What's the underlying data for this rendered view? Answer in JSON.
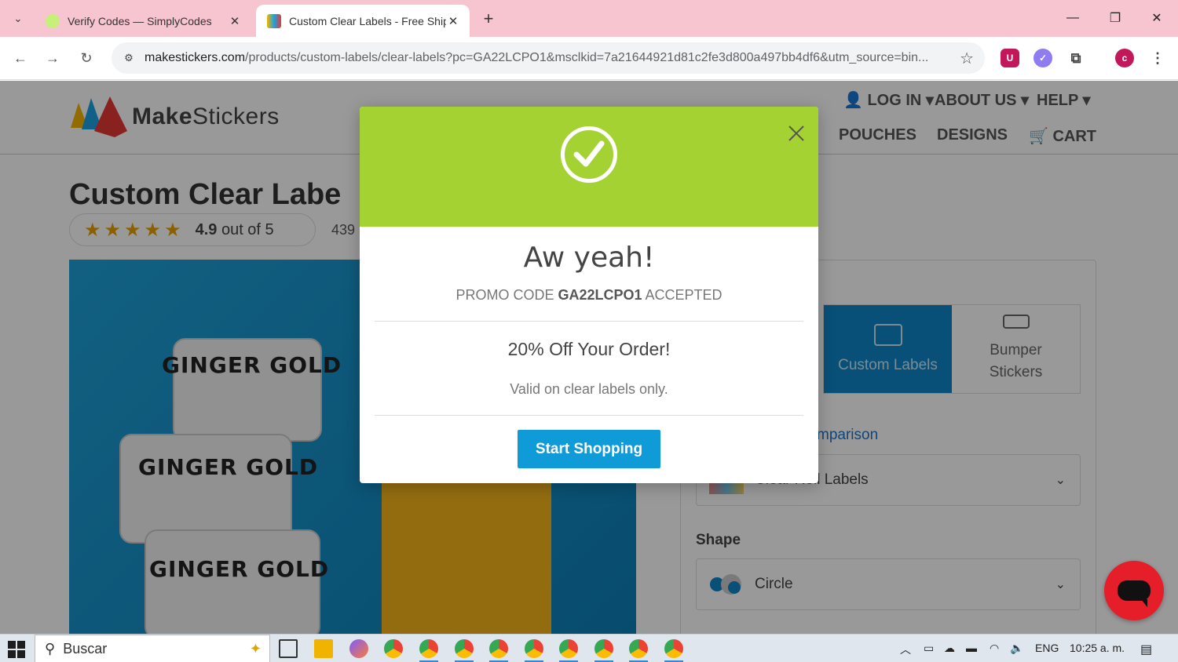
{
  "browser": {
    "tabs": [
      {
        "title": "Verify Codes — SimplyCodes",
        "active": false
      },
      {
        "title": "Custom Clear Labels - Free Shipping",
        "active": true
      }
    ],
    "url_main": "makestickers.com",
    "url_rest": "/products/custom-labels/clear-labels?pc=GA22LCPO1&msclkid=7a21644921d81c2fe3d800a497bb4df6&utm_source=bin...",
    "profile_initial": "c"
  },
  "site": {
    "logo_bold": "Make",
    "logo_light": "Stickers",
    "topnav": {
      "login": "LOG IN",
      "about": "ABOUT US",
      "help": "HELP"
    },
    "mainnav": {
      "pouches": "POUCHES",
      "designs": "DESIGNS",
      "cart": "CART"
    }
  },
  "product": {
    "title": "Custom Clear Labe",
    "stars": "★★★★★",
    "rating_value": "4.9",
    "rating_suffix": " out of 5",
    "review_count": "439",
    "roll_label": "GINGER GOLD",
    "types": [
      {
        "label": "Custom Labels",
        "active": true
      },
      {
        "label": "Bumper Stickers",
        "active": false
      }
    ],
    "comparison_link": "mparison",
    "material_value": "Clear Roll Labels",
    "shape_label": "Shape",
    "shape_value": "Circle"
  },
  "modal": {
    "title": "Aw yeah!",
    "promo_prefix": "PROMO CODE ",
    "promo_code": "GA22LCPO1",
    "promo_suffix": " ACCEPTED",
    "offer": "20% Off Your Order!",
    "validity": "Valid on clear labels only.",
    "cta": "Start Shopping",
    "accent_color": "#a4d233",
    "button_color": "#0f9bd7"
  },
  "taskbar": {
    "search_placeholder": "Buscar",
    "language": "ENG",
    "time": "10:25 a. m."
  }
}
